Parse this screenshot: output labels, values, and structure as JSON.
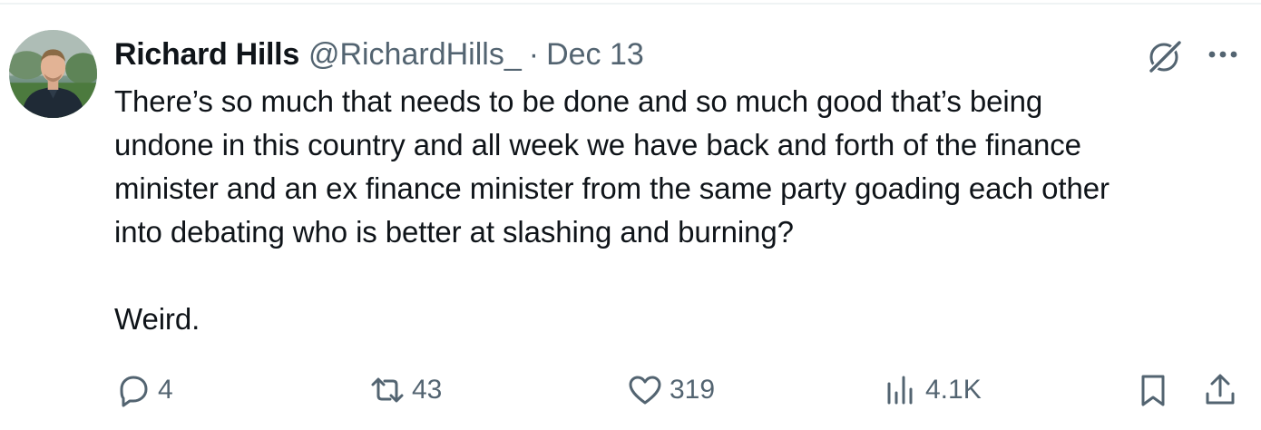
{
  "author": {
    "name": "Richard Hills",
    "handle": "@RichardHills_",
    "separator": "·",
    "date": "Dec 13"
  },
  "tweet": {
    "text": "There’s so much that needs to be done and so much good that’s being\nundone in this country and all week we have back and forth of the finance\nminister and an ex finance minister from the same party goading each other\ninto debating who is better at slashing and burning?\n\nWeird."
  },
  "actions": {
    "replies": "4",
    "retweets": "43",
    "likes": "319",
    "views": "4.1K"
  },
  "icons": {
    "reply": "reply-icon",
    "retweet": "retweet-icon",
    "like": "heart-icon",
    "views": "views-icon",
    "bookmark": "bookmark-icon",
    "share": "share-icon",
    "grok": "grok-icon",
    "more": "more-icon"
  },
  "colors": {
    "text": "#0f1419",
    "secondary": "#536471",
    "border": "#eff3f4"
  }
}
